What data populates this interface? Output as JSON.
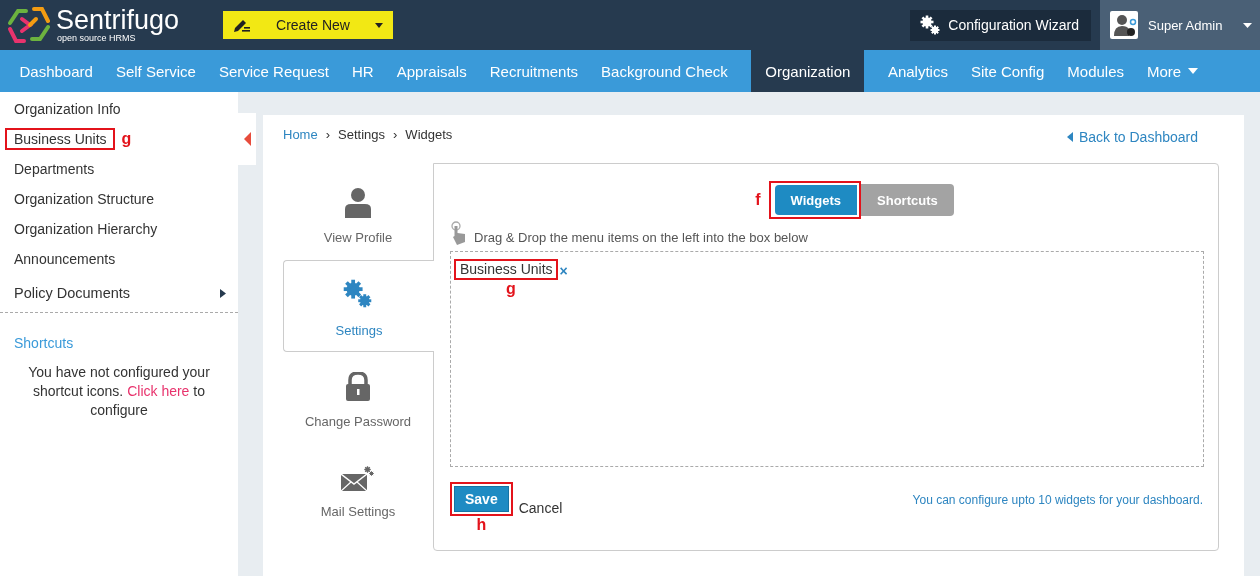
{
  "brand": {
    "name": "Sentrifugo",
    "tagline": "open source HRMS"
  },
  "create_button": {
    "label": "Create New"
  },
  "config_wizard": {
    "label": "Configuration Wizard"
  },
  "user": {
    "name": "Super Admin"
  },
  "nav": [
    {
      "label": "Dashboard",
      "selected": false,
      "kind": "link"
    },
    {
      "label": "Self Service",
      "selected": false,
      "kind": "link"
    },
    {
      "label": "Service Request",
      "selected": false,
      "kind": "link"
    },
    {
      "label": "HR",
      "selected": false,
      "kind": "link"
    },
    {
      "label": "Appraisals",
      "selected": false,
      "kind": "link"
    },
    {
      "label": "Recruitments",
      "selected": false,
      "kind": "link"
    },
    {
      "label": "Background Check",
      "selected": false,
      "kind": "link"
    },
    {
      "label": "Organization",
      "selected": true,
      "kind": "link"
    },
    {
      "label": "Analytics",
      "selected": false,
      "kind": "link"
    },
    {
      "label": "Site Config",
      "selected": false,
      "kind": "link"
    },
    {
      "label": "Modules",
      "selected": false,
      "kind": "link"
    },
    {
      "label": "More",
      "selected": false,
      "kind": "dropdown"
    }
  ],
  "sidebar": {
    "items": [
      {
        "label": "Organization Info",
        "kind": "link"
      },
      {
        "label": "Business Units",
        "kind": "link",
        "annotation": "g"
      },
      {
        "label": "Departments",
        "kind": "link"
      },
      {
        "label": "Organization Structure",
        "kind": "link"
      },
      {
        "label": "Organization Hierarchy",
        "kind": "link"
      },
      {
        "label": "Announcements",
        "kind": "link"
      },
      {
        "label": "Policy Documents",
        "kind": "submenu"
      }
    ],
    "shortcuts": {
      "title": "Shortcuts",
      "before": "You have not configured your shortcut icons. ",
      "link": "Click here",
      "after": " to configure"
    }
  },
  "breadcrumb": [
    {
      "label": "Home",
      "kind": "link"
    },
    {
      "label": "›",
      "kind": "separator"
    },
    {
      "label": "Settings",
      "kind": "text"
    },
    {
      "label": "›",
      "kind": "separator"
    },
    {
      "label": "Widgets",
      "kind": "text"
    }
  ],
  "back_link": "Back to Dashboard",
  "settings_tabs": [
    {
      "label": "View Profile",
      "kind": "profile",
      "selected": false
    },
    {
      "label": "Settings",
      "kind": "settings",
      "selected": true
    },
    {
      "label": "Change Password",
      "kind": "password",
      "selected": false
    },
    {
      "label": "Mail Settings",
      "kind": "mail",
      "selected": false
    }
  ],
  "toggle": [
    {
      "label": "Widgets",
      "selected": true,
      "annotation": "f"
    },
    {
      "label": "Shortcuts",
      "selected": false
    }
  ],
  "hint": "Drag & Drop the menu items on the left into the box below",
  "drop_box": {
    "items": [
      {
        "label": "Business Units",
        "remove": "×",
        "annotation": "g"
      }
    ]
  },
  "save_button": {
    "label": "Save",
    "annotation": "h"
  },
  "cancel": "Cancel",
  "limit_note": "You can configure upto 10 widgets for your dashboard."
}
